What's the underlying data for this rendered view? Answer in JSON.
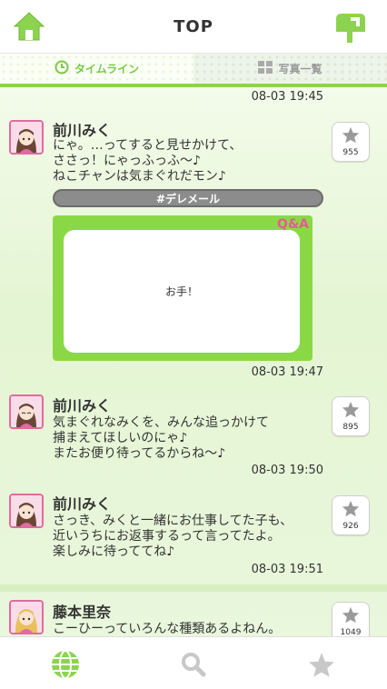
{
  "header": {
    "title": "TOP"
  },
  "tabs": [
    {
      "label": "タイムライン",
      "active": true
    },
    {
      "label": "写真一覧",
      "active": false
    }
  ],
  "timeline": {
    "top_timestamp": "08-03 19:45",
    "posts": [
      {
        "author": "前川みく",
        "message": "にゃ。…ってすると見せかけて、\nささっ！にゃっふっふ〜♪\nねこチャンは気まぐれだモン♪",
        "star_count": "955",
        "tag": "#デレメール",
        "qa_badge": "Q&A",
        "qa_text": "お手！",
        "timestamp": "08-03 19:47"
      },
      {
        "author": "前川みく",
        "message": "気まぐれなみくを、みんな追っかけて\n捕まえてほしいのにゃ♪\nまたお便り待ってるからね〜♪",
        "star_count": "895",
        "timestamp": "08-03 19:50"
      },
      {
        "author": "前川みく",
        "message": "さっき、みくと一緒にお仕事してた子も、\n近いうちにお返事するって言ってたよ。\n楽しみに待っててね♪",
        "star_count": "926",
        "timestamp": "08-03 19:51"
      },
      {
        "author": "藤本里奈",
        "message": "こーひーっていろんな種類あるよねん。",
        "star_count": "1049"
      }
    ]
  },
  "colors": {
    "accent": "#8dd34f",
    "tag_bar": "#8c8c8c",
    "avatar_border": "#e26aa0"
  }
}
